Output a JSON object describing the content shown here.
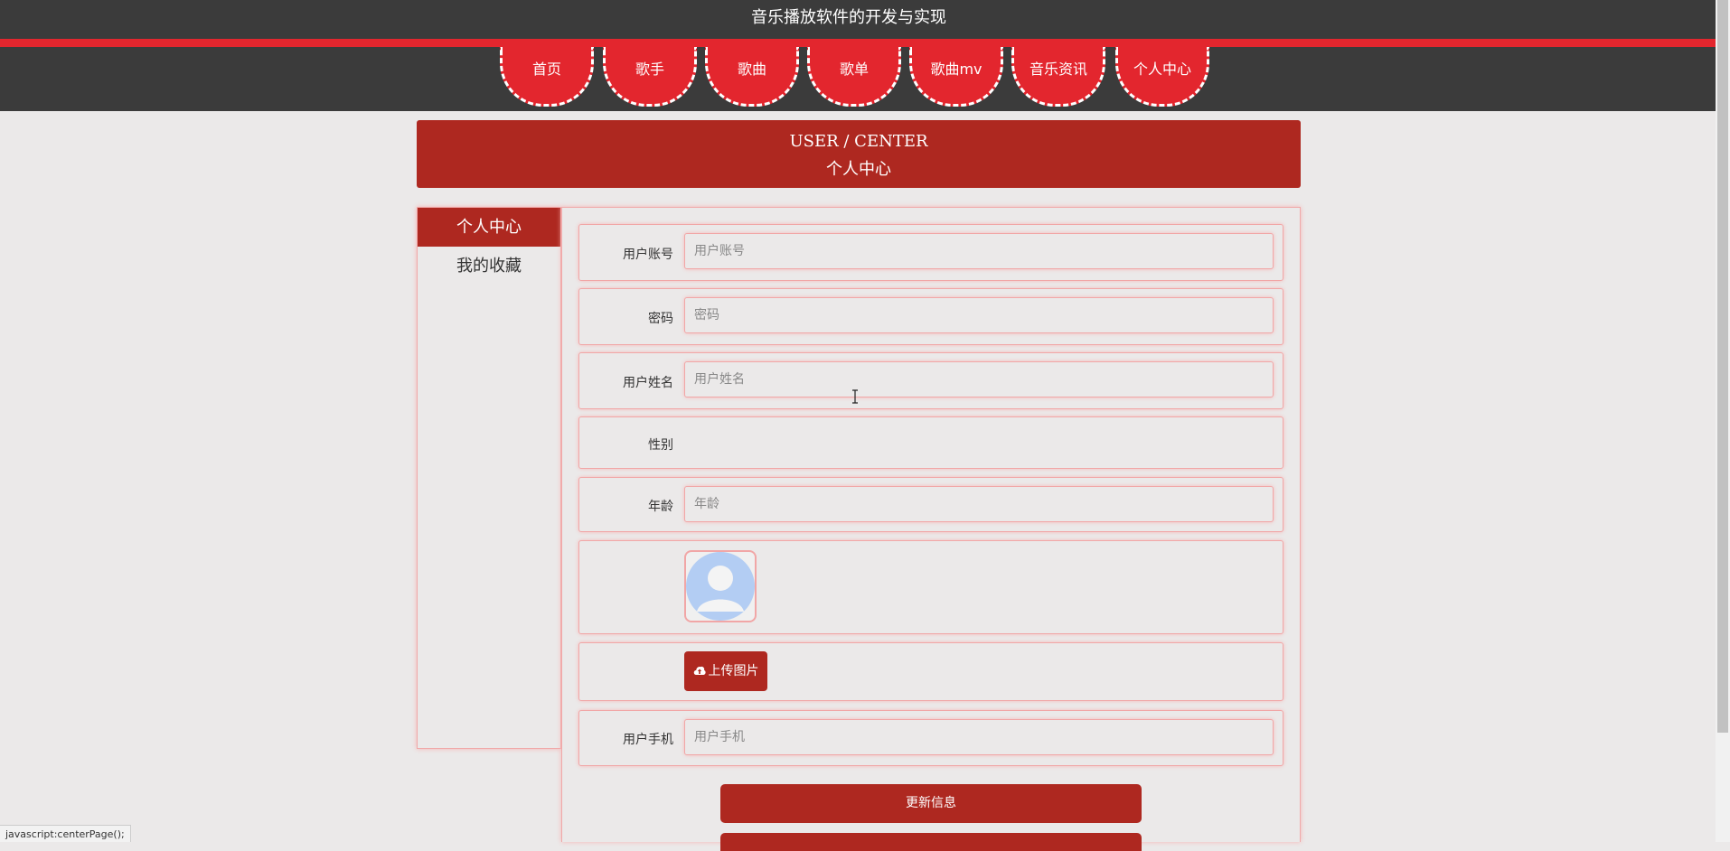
{
  "site_title": "音乐播放软件的开发与实现",
  "nav": [
    "首页",
    "歌手",
    "歌曲",
    "歌单",
    "歌曲mv",
    "音乐资讯",
    "个人中心"
  ],
  "banner": {
    "en": "USER / CENTER",
    "cn": "个人中心"
  },
  "sidebar": {
    "active": "个人中心",
    "items": [
      "我的收藏"
    ]
  },
  "form": {
    "account": {
      "label": "用户账号",
      "placeholder": "用户账号"
    },
    "password": {
      "label": "密码",
      "placeholder": "密码"
    },
    "name": {
      "label": "用户姓名",
      "placeholder": "用户姓名"
    },
    "gender": {
      "label": "性别"
    },
    "age": {
      "label": "年龄",
      "placeholder": "年龄"
    },
    "upload_label": "上传图片",
    "phone": {
      "label": "用户手机",
      "placeholder": "用户手机"
    },
    "update_label": "更新信息"
  },
  "status_bar": "javascript:centerPage();",
  "colors": {
    "accent": "#ae2820",
    "nav_red": "#e3262e",
    "header_dark": "#3b3b3b"
  }
}
